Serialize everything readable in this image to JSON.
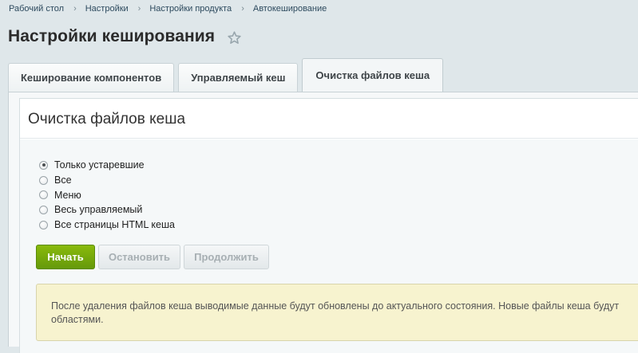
{
  "breadcrumb": {
    "items": [
      "Рабочий стол",
      "Настройки",
      "Настройки продукта",
      "Автокеширование"
    ],
    "separator": "›"
  },
  "page": {
    "title": "Настройки кеширования"
  },
  "tabs": [
    {
      "label": "Кеширование компонентов",
      "active": false
    },
    {
      "label": "Управляемый кеш",
      "active": false
    },
    {
      "label": "Очистка файлов кеша",
      "active": true
    }
  ],
  "section": {
    "title": "Очистка файлов кеша"
  },
  "options": [
    {
      "label": "Только устаревшие",
      "checked": true
    },
    {
      "label": "Все",
      "checked": false
    },
    {
      "label": "Меню",
      "checked": false
    },
    {
      "label": "Весь управляемый",
      "checked": false
    },
    {
      "label": "Все страницы HTML кеша",
      "checked": false
    }
  ],
  "buttons": {
    "start_label": "Начать",
    "stop_label": "Остановить",
    "continue_label": "Продолжить"
  },
  "notice": {
    "line1": "После удаления файлов кеша выводимые данные будут обновлены до актуального состояния. Новые файлы кеша будут",
    "line2": "областями."
  },
  "colors": {
    "primary_button": "#7aad0b",
    "notice_background": "#f7f3cf",
    "page_background": "#dfe7ea"
  },
  "icons": {
    "favorite": "star-outline-icon"
  }
}
